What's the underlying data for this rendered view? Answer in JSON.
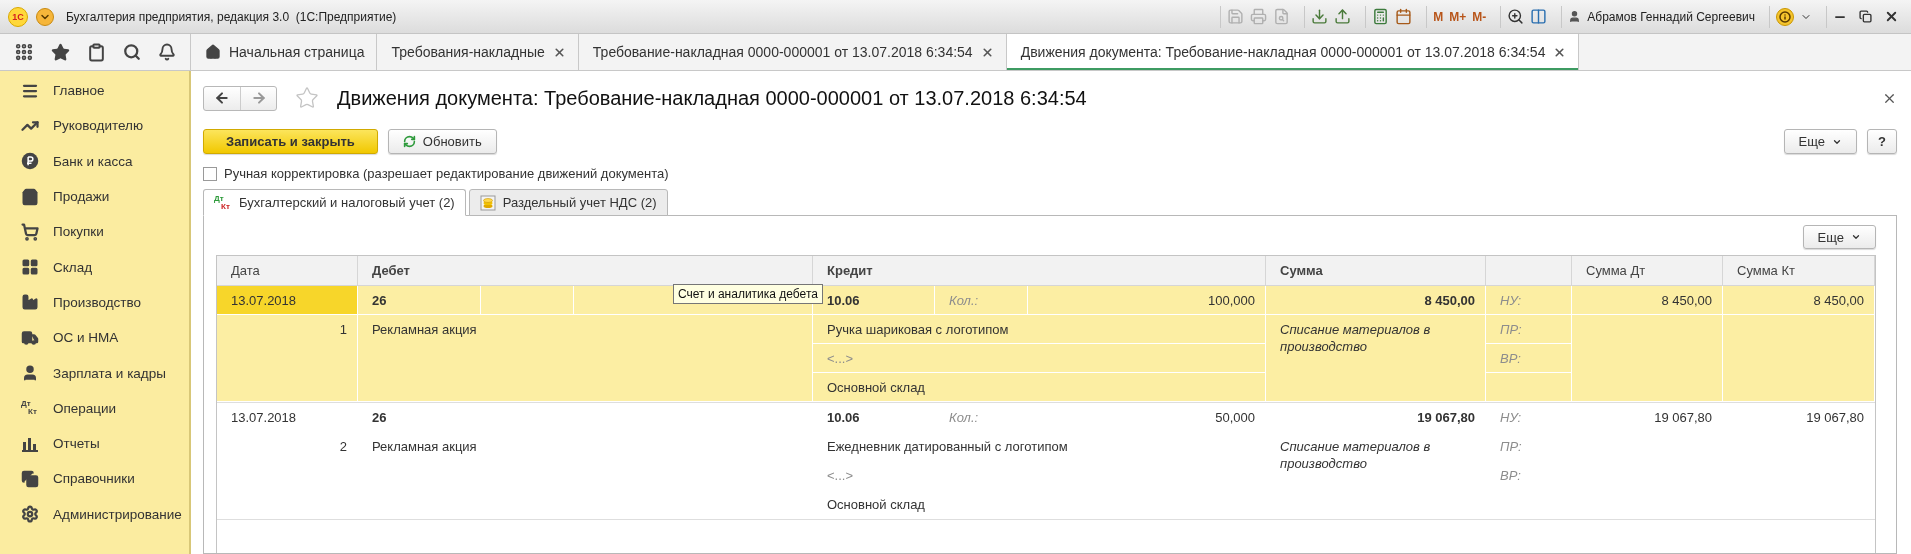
{
  "window": {
    "logo": "1С",
    "title": "Бухгалтерия предприятия, редакция 3.0  (1С:Предприятие)"
  },
  "toolbar": {
    "memory": [
      "M",
      "M+",
      "M-"
    ],
    "user": "Абрамов Геннадий Сергеевич"
  },
  "open_tabs": [
    {
      "label": "Начальная страница",
      "kind": "home",
      "selected": false
    },
    {
      "label": "Требования-накладные",
      "kind": "document",
      "selected": false
    },
    {
      "label": "Требование-накладная 0000-000001 от 13.07.2018 6:34:54",
      "kind": "document",
      "selected": false
    },
    {
      "label": "Движения документа: Требование-накладная 0000-000001 от 13.07.2018 6:34:54",
      "kind": "document",
      "selected": true
    }
  ],
  "sidebar": {
    "items": [
      {
        "label": "Главное"
      },
      {
        "label": "Руководителю"
      },
      {
        "label": "Банк и касса"
      },
      {
        "label": "Продажи"
      },
      {
        "label": "Покупки"
      },
      {
        "label": "Склад"
      },
      {
        "label": "Производство"
      },
      {
        "label": "ОС и НМА"
      },
      {
        "label": "Зарплата и кадры"
      },
      {
        "label": "Операции",
        "icon_text": [
          "Дт",
          "Кт"
        ]
      },
      {
        "label": "Отчеты"
      },
      {
        "label": "Справочники"
      },
      {
        "label": "Администрирование"
      }
    ]
  },
  "form": {
    "title": "Движения документа: Требование-накладная 0000-000001 от 13.07.2018 6:34:54",
    "buttons": {
      "primary": "Записать и закрыть",
      "refresh": "Обновить",
      "more": "Еще",
      "help": "?"
    },
    "manual_edit": {
      "label": "Ручная корректировка (разрешает редактирование движений документа)",
      "checked": false
    },
    "tabs": [
      {
        "label": "Бухгалтерский и налоговый учет (2)",
        "selected": true,
        "icon_text": [
          "Дт",
          "Кт"
        ]
      },
      {
        "label": "Раздельный учет НДС (2)",
        "selected": false
      }
    ],
    "grid": {
      "more": "Еще",
      "tooltip": "Счет и аналитика дебета",
      "columns": [
        {
          "label": "Дата",
          "bold": false
        },
        {
          "label": "Дебет",
          "bold": true
        },
        {
          "label": "Кредит",
          "bold": true
        },
        {
          "label": "Сумма",
          "bold": true
        },
        {
          "label": "Сумма Дт",
          "bold": false
        },
        {
          "label": "Сумма Кт",
          "bold": false
        }
      ],
      "rows": [
        {
          "selected": true,
          "date": "13.07.2018",
          "number": "1",
          "debit": {
            "account": "26",
            "subconto": "Рекламная акция"
          },
          "credit": {
            "account": "10.06",
            "quantity_label": "Кол.:",
            "quantity": "100,000",
            "subconto": [
              "Ручка шариковая с логотипом",
              "<...>",
              "Основной склад"
            ]
          },
          "amount": "8 450,00",
          "content": "Списание материалов в производство",
          "tax_labels": [
            "НУ:",
            "ПР:",
            "ВР:"
          ],
          "amount_dt": "8 450,00",
          "amount_kt": "8 450,00"
        },
        {
          "selected": false,
          "date": "13.07.2018",
          "number": "2",
          "debit": {
            "account": "26",
            "subconto": "Рекламная акция"
          },
          "credit": {
            "account": "10.06",
            "quantity_label": "Кол.:",
            "quantity": "50,000",
            "subconto": [
              "Ежедневник датированный с логотипом",
              "<...>",
              "Основной склад"
            ]
          },
          "amount": "19 067,80",
          "content": "Списание материалов в производство",
          "tax_labels": [
            "НУ:",
            "ПР:",
            "ВР:"
          ],
          "amount_dt": "19 067,80",
          "amount_kt": "19 067,80"
        }
      ]
    }
  }
}
